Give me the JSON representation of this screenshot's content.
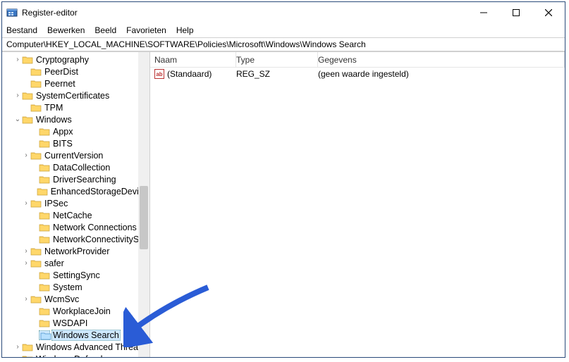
{
  "window": {
    "title": "Register-editor"
  },
  "menu": {
    "items": [
      "Bestand",
      "Bewerken",
      "Beeld",
      "Favorieten",
      "Help"
    ]
  },
  "address": "Computer\\HKEY_LOCAL_MACHINE\\SOFTWARE\\Policies\\Microsoft\\Windows\\Windows Search",
  "tree": [
    {
      "indent": 1,
      "twisty": ">",
      "label": "Cryptography"
    },
    {
      "indent": 2,
      "twisty": "",
      "label": "PeerDist"
    },
    {
      "indent": 2,
      "twisty": "",
      "label": "Peernet"
    },
    {
      "indent": 1,
      "twisty": ">",
      "label": "SystemCertificates"
    },
    {
      "indent": 2,
      "twisty": "",
      "label": "TPM"
    },
    {
      "indent": 1,
      "twisty": "v",
      "label": "Windows"
    },
    {
      "indent": 3,
      "twisty": "",
      "label": "Appx"
    },
    {
      "indent": 3,
      "twisty": "",
      "label": "BITS"
    },
    {
      "indent": 2,
      "twisty": ">",
      "label": "CurrentVersion"
    },
    {
      "indent": 3,
      "twisty": "",
      "label": "DataCollection"
    },
    {
      "indent": 3,
      "twisty": "",
      "label": "DriverSearching"
    },
    {
      "indent": 3,
      "twisty": "",
      "label": "EnhancedStorageDevice"
    },
    {
      "indent": 2,
      "twisty": ">",
      "label": "IPSec"
    },
    {
      "indent": 3,
      "twisty": "",
      "label": "NetCache"
    },
    {
      "indent": 3,
      "twisty": "",
      "label": "Network Connections"
    },
    {
      "indent": 3,
      "twisty": "",
      "label": "NetworkConnectivitySt"
    },
    {
      "indent": 2,
      "twisty": ">",
      "label": "NetworkProvider"
    },
    {
      "indent": 2,
      "twisty": ">",
      "label": "safer"
    },
    {
      "indent": 3,
      "twisty": "",
      "label": "SettingSync"
    },
    {
      "indent": 3,
      "twisty": "",
      "label": "System"
    },
    {
      "indent": 2,
      "twisty": ">",
      "label": "WcmSvc"
    },
    {
      "indent": 3,
      "twisty": "",
      "label": "WorkplaceJoin"
    },
    {
      "indent": 3,
      "twisty": "",
      "label": "WSDAPI"
    },
    {
      "indent": 3,
      "twisty": "",
      "label": "Windows Search",
      "selected": true
    },
    {
      "indent": 1,
      "twisty": ">",
      "label": "Windows Advanced Threa"
    },
    {
      "indent": 1,
      "twisty": ">",
      "label": "Windows Defender"
    }
  ],
  "columns": {
    "name": "Naam",
    "type": "Type",
    "data": "Gegevens"
  },
  "rows": [
    {
      "name": "(Standaard)",
      "type": "REG_SZ",
      "data": "(geen waarde ingesteld)"
    }
  ],
  "icons": {
    "regsz": "ab"
  }
}
